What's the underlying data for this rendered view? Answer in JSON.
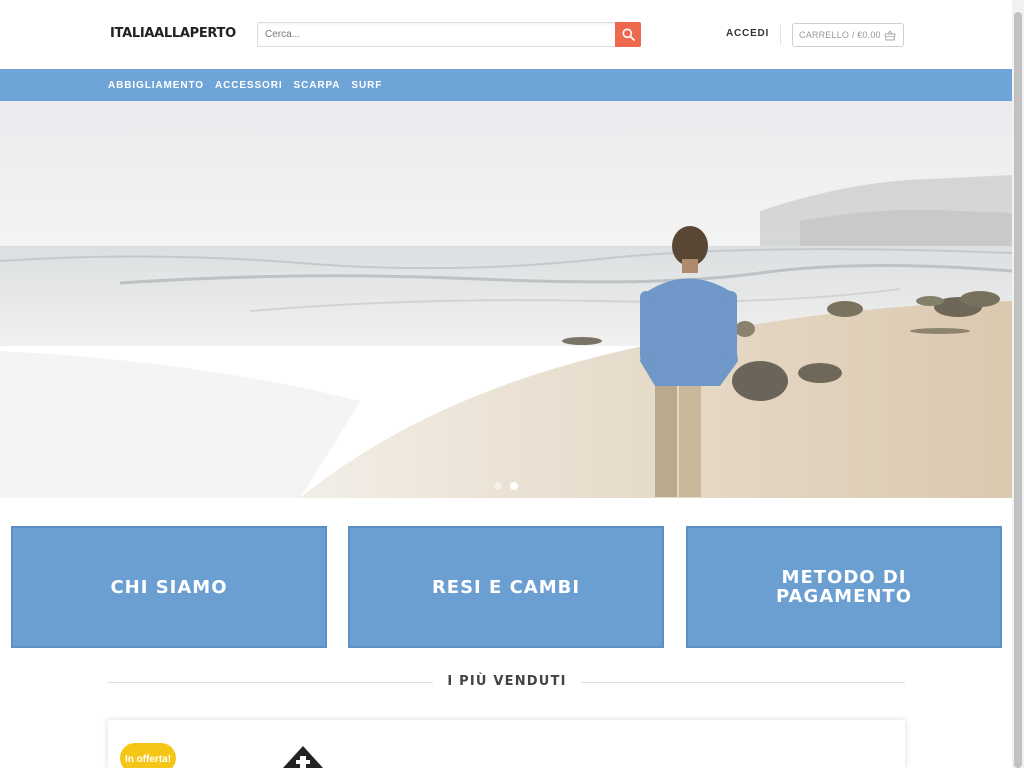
{
  "header": {
    "logo": "ITALIAALLAPERTO",
    "search_placeholder": "Cerca...",
    "login_label": "ACCEDI",
    "cart_label": "CARRELLO / €0.00"
  },
  "nav": {
    "items": [
      "ABBIGLIAMENTO",
      "ACCESSORI",
      "SCARPA",
      "SURF"
    ]
  },
  "hero": {
    "image": "man-walking-on-beach",
    "slides": 2,
    "active_slide": 2
  },
  "features": [
    {
      "label": "CHI SIAMO"
    },
    {
      "label": "RESI E CAMBI"
    },
    {
      "label": "METODO DI PAGAMENTO"
    }
  ],
  "bestsellers": {
    "title": "I PIÙ VENDUTI",
    "badge": "In offerta!"
  },
  "colors": {
    "nav_bg": "#6ea4d8",
    "box_bg": "#6b9fd2",
    "search_button": "#ed6a4f",
    "badge": "#f5c518"
  }
}
